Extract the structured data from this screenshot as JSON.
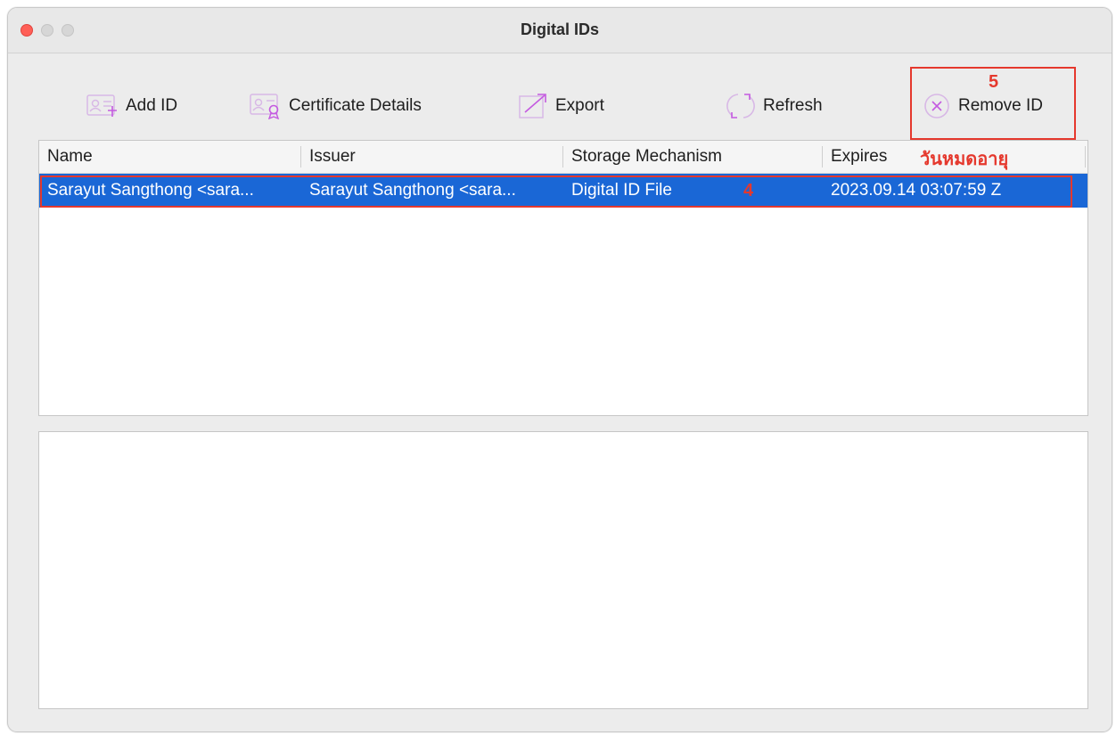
{
  "window": {
    "title": "Digital IDs"
  },
  "toolbar": {
    "add_id": "Add ID",
    "certificate_details": "Certificate Details",
    "export": "Export",
    "refresh": "Refresh",
    "remove_id": "Remove ID"
  },
  "table": {
    "columns": [
      "Name",
      "Issuer",
      "Storage Mechanism",
      "Expires"
    ],
    "rows": [
      {
        "name": "Sarayut Sangthong <sara...",
        "issuer": "Sarayut Sangthong <sara...",
        "storage": "Digital ID File",
        "expires": "2023.09.14 03:07:59 Z"
      }
    ]
  },
  "annotations": {
    "step5": "5",
    "step4": "4",
    "expiry_label": "วันหมดอายุ"
  },
  "colors": {
    "accent_selection": "#1a67d6",
    "annotation_red": "#e5382d",
    "icon_purple": "#c45ae0"
  },
  "icons": [
    "add-id-icon",
    "certificate-icon",
    "export-icon",
    "refresh-icon",
    "remove-icon"
  ]
}
